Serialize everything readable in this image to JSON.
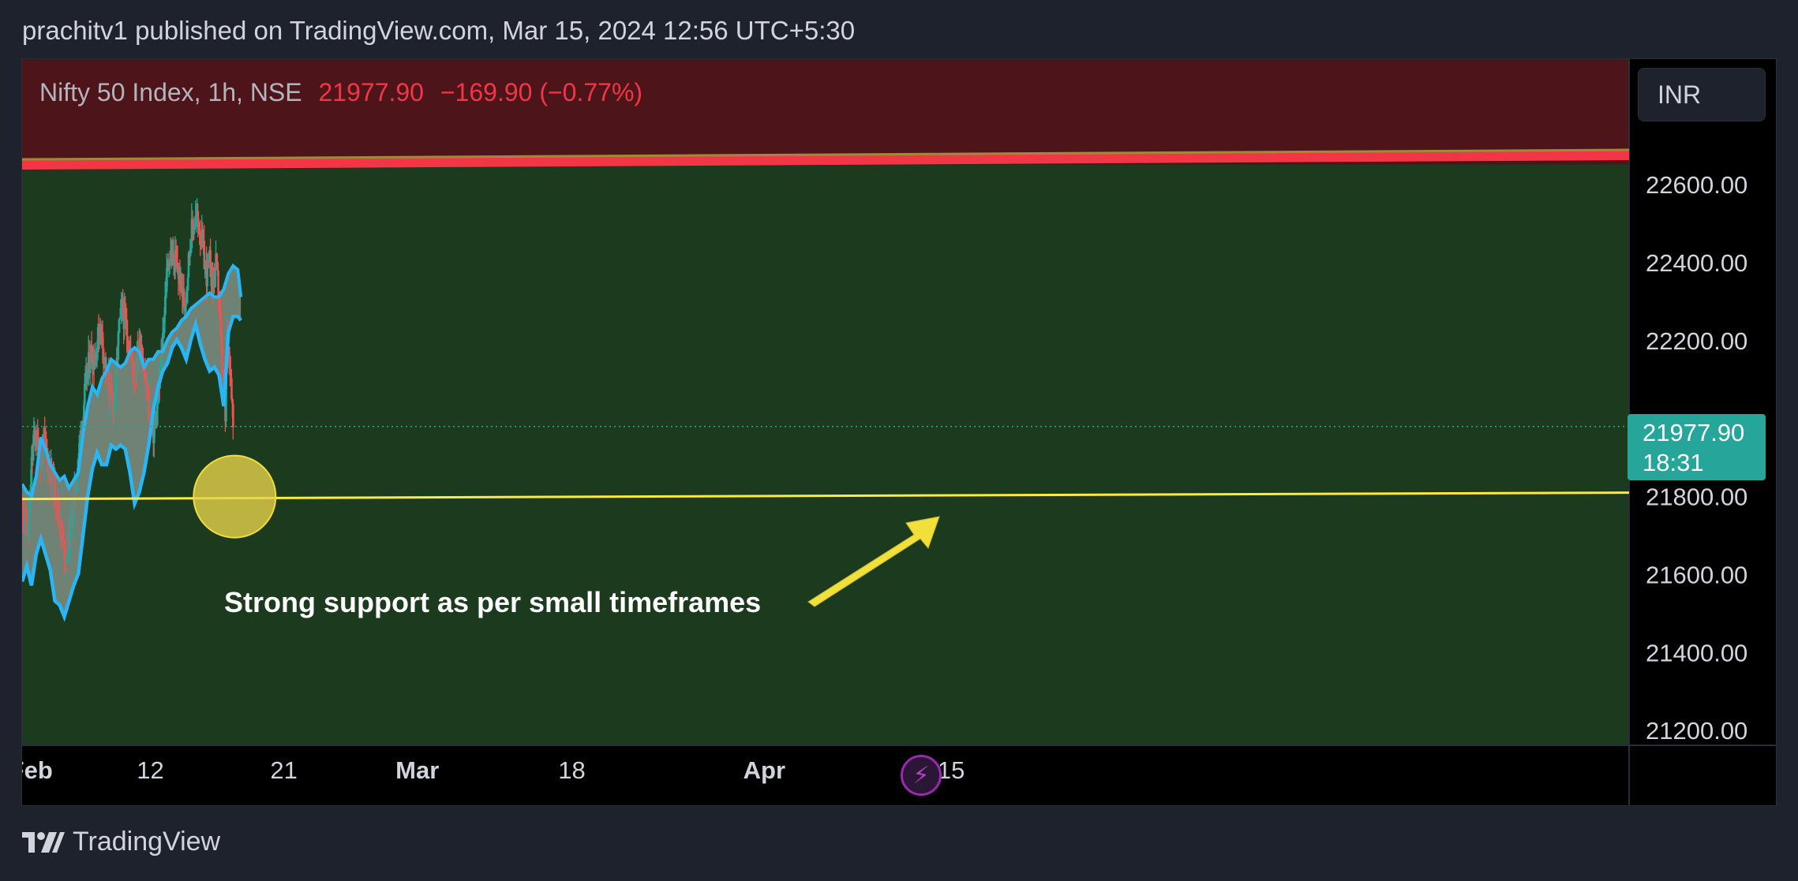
{
  "header": {
    "attribution": "prachitv1 published on TradingView.com, Mar 15, 2024 12:56 UTC+5:30"
  },
  "legend": {
    "symbol": "Nifty 50 Index, 1h, NSE",
    "last": "21977.90",
    "change": "−169.90 (−0.77%)"
  },
  "currency": {
    "label": "INR"
  },
  "price_badge": {
    "price": "21977.90",
    "countdown": "18:31"
  },
  "annotation": {
    "text": "Strong support as per small timeframes"
  },
  "footer": {
    "brand": "TradingView",
    "logo_icon": "tradingview-logo-icon"
  },
  "event_icon": "lightning-icon",
  "colors": {
    "up": "#26a69a",
    "down": "#ef5350",
    "resistance_zone": "#4d1519",
    "support_zone": "#1b3a1e",
    "resistance_line": "#f23645",
    "support_line": "#ffeb3b",
    "cloud_border": "#29b6f6",
    "cloud_fill": "#7f8f83",
    "accent_badge": "#26a69a"
  },
  "chart_data": {
    "type": "candlestick",
    "title": "Nifty 50 Index, 1h, NSE",
    "ylim": [
      21160,
      22920
    ],
    "y_ticks": [
      "22600.00",
      "22400.00",
      "22200.00",
      "21800.00",
      "21600.00",
      "21400.00",
      "21200.00"
    ],
    "x_ticks": [
      "Feb",
      "12",
      "21",
      "Mar",
      "18",
      "Apr",
      "15"
    ],
    "x_tick_bold": [
      "Feb",
      "Mar",
      "Apr"
    ],
    "last_price": 21977.9,
    "resistance_zone_from": 22650,
    "resistance_line": 22665,
    "support_line": 21800,
    "close_path": [
      [
        0,
        21780
      ],
      [
        2,
        21740
      ],
      [
        4,
        21700
      ],
      [
        6,
        21880
      ],
      [
        8,
        21960
      ],
      [
        10,
        21930
      ],
      [
        12,
        21890
      ],
      [
        14,
        21940
      ],
      [
        16,
        21900
      ],
      [
        18,
        21860
      ],
      [
        20,
        21830
      ],
      [
        22,
        21790
      ],
      [
        24,
        21740
      ],
      [
        26,
        21680
      ],
      [
        28,
        21640
      ],
      [
        30,
        21700
      ],
      [
        32,
        21760
      ],
      [
        34,
        21820
      ],
      [
        36,
        21900
      ],
      [
        38,
        21980
      ],
      [
        40,
        22060
      ],
      [
        42,
        22120
      ],
      [
        44,
        22170
      ],
      [
        46,
        22150
      ],
      [
        48,
        22190
      ],
      [
        50,
        22240
      ],
      [
        52,
        22180
      ],
      [
        54,
        22110
      ],
      [
        56,
        22060
      ],
      [
        58,
        22020
      ],
      [
        60,
        22100
      ],
      [
        62,
        22230
      ],
      [
        64,
        22280
      ],
      [
        66,
        22240
      ],
      [
        68,
        22200
      ],
      [
        70,
        22150
      ],
      [
        72,
        22120
      ],
      [
        74,
        22160
      ],
      [
        76,
        22200
      ],
      [
        78,
        22130
      ],
      [
        80,
        22050
      ],
      [
        82,
        22000
      ],
      [
        84,
        21960
      ],
      [
        86,
        22000
      ],
      [
        88,
        22090
      ],
      [
        90,
        22210
      ],
      [
        92,
        22340
      ],
      [
        94,
        22420
      ],
      [
        96,
        22410
      ],
      [
        98,
        22400
      ],
      [
        100,
        22370
      ],
      [
        102,
        22330
      ],
      [
        104,
        22290
      ],
      [
        106,
        22380
      ],
      [
        108,
        22470
      ],
      [
        110,
        22500
      ],
      [
        112,
        22510
      ],
      [
        114,
        22480
      ],
      [
        116,
        22420
      ],
      [
        118,
        22370
      ],
      [
        120,
        22400
      ],
      [
        122,
        22340
      ],
      [
        124,
        22390
      ],
      [
        126,
        22310
      ],
      [
        128,
        22100
      ],
      [
        130,
        21990
      ],
      [
        131,
        22220
      ],
      [
        133,
        22140
      ],
      [
        134,
        22080
      ],
      [
        135,
        21977.9
      ]
    ],
    "cloud": {
      "upper": [
        [
          0,
          21830
        ],
        [
          3,
          21810
        ],
        [
          6,
          21800
        ],
        [
          9,
          21850
        ],
        [
          12,
          21950
        ],
        [
          15,
          21920
        ],
        [
          18,
          21880
        ],
        [
          21,
          21860
        ],
        [
          24,
          21840
        ],
        [
          27,
          21850
        ],
        [
          30,
          21820
        ],
        [
          33,
          21840
        ],
        [
          36,
          21860
        ],
        [
          39,
          21960
        ],
        [
          42,
          22030
        ],
        [
          45,
          22080
        ],
        [
          48,
          22060
        ],
        [
          51,
          22100
        ],
        [
          54,
          22120
        ],
        [
          57,
          22150
        ],
        [
          60,
          22140
        ],
        [
          63,
          22130
        ],
        [
          66,
          22140
        ],
        [
          69,
          22170
        ],
        [
          72,
          22180
        ],
        [
          75,
          22170
        ],
        [
          78,
          22130
        ],
        [
          81,
          22150
        ],
        [
          84,
          22150
        ],
        [
          87,
          22170
        ],
        [
          90,
          22170
        ],
        [
          93,
          22200
        ],
        [
          96,
          22220
        ],
        [
          99,
          22230
        ],
        [
          102,
          22250
        ],
        [
          105,
          22260
        ],
        [
          108,
          22280
        ],
        [
          111,
          22290
        ],
        [
          114,
          22300
        ],
        [
          117,
          22310
        ],
        [
          120,
          22320
        ],
        [
          123,
          22310
        ],
        [
          126,
          22310
        ],
        [
          129,
          22330
        ],
        [
          132,
          22370
        ],
        [
          135,
          22390
        ],
        [
          138,
          22380
        ],
        [
          140,
          22310
        ]
      ],
      "lower": [
        [
          0,
          21580
        ],
        [
          3,
          21620
        ],
        [
          6,
          21570
        ],
        [
          9,
          21650
        ],
        [
          12,
          21690
        ],
        [
          15,
          21650
        ],
        [
          18,
          21610
        ],
        [
          21,
          21530
        ],
        [
          24,
          21520
        ],
        [
          27,
          21490
        ],
        [
          30,
          21530
        ],
        [
          33,
          21570
        ],
        [
          36,
          21600
        ],
        [
          39,
          21700
        ],
        [
          42,
          21800
        ],
        [
          45,
          21870
        ],
        [
          48,
          21910
        ],
        [
          51,
          21880
        ],
        [
          54,
          21880
        ],
        [
          57,
          21930
        ],
        [
          60,
          21920
        ],
        [
          63,
          21930
        ],
        [
          66,
          21920
        ],
        [
          69,
          21860
        ],
        [
          72,
          21780
        ],
        [
          75,
          21810
        ],
        [
          78,
          21860
        ],
        [
          81,
          21930
        ],
        [
          84,
          22020
        ],
        [
          87,
          22080
        ],
        [
          90,
          22120
        ],
        [
          93,
          22140
        ],
        [
          96,
          22180
        ],
        [
          99,
          22200
        ],
        [
          102,
          22180
        ],
        [
          105,
          22150
        ],
        [
          108,
          22200
        ],
        [
          111,
          22240
        ],
        [
          114,
          22190
        ],
        [
          117,
          22150
        ],
        [
          120,
          22120
        ],
        [
          123,
          22130
        ],
        [
          126,
          22110
        ],
        [
          129,
          22030
        ],
        [
          132,
          22220
        ],
        [
          135,
          22260
        ],
        [
          138,
          22260
        ],
        [
          140,
          22250
        ]
      ]
    }
  }
}
